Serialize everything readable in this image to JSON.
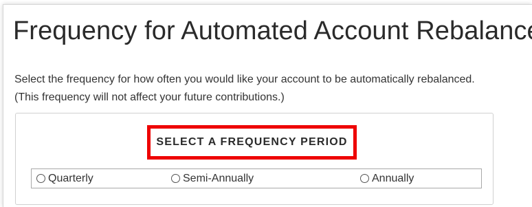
{
  "page": {
    "title": "Frequency for Automated Account Rebalance",
    "description": "Select the frequency for how often you would like your account to be automatically rebalanced. (This frequency will not affect your future contributions.)"
  },
  "frequency": {
    "heading": "SELECT A FREQUENCY PERIOD",
    "options": [
      {
        "label": "Quarterly",
        "selected": false
      },
      {
        "label": "Semi-Annually",
        "selected": false
      },
      {
        "label": "Annually",
        "selected": false
      }
    ]
  },
  "colors": {
    "highlight_border": "#ee0000",
    "text": "#2a2a2a",
    "box_border": "#d0d0d0"
  }
}
